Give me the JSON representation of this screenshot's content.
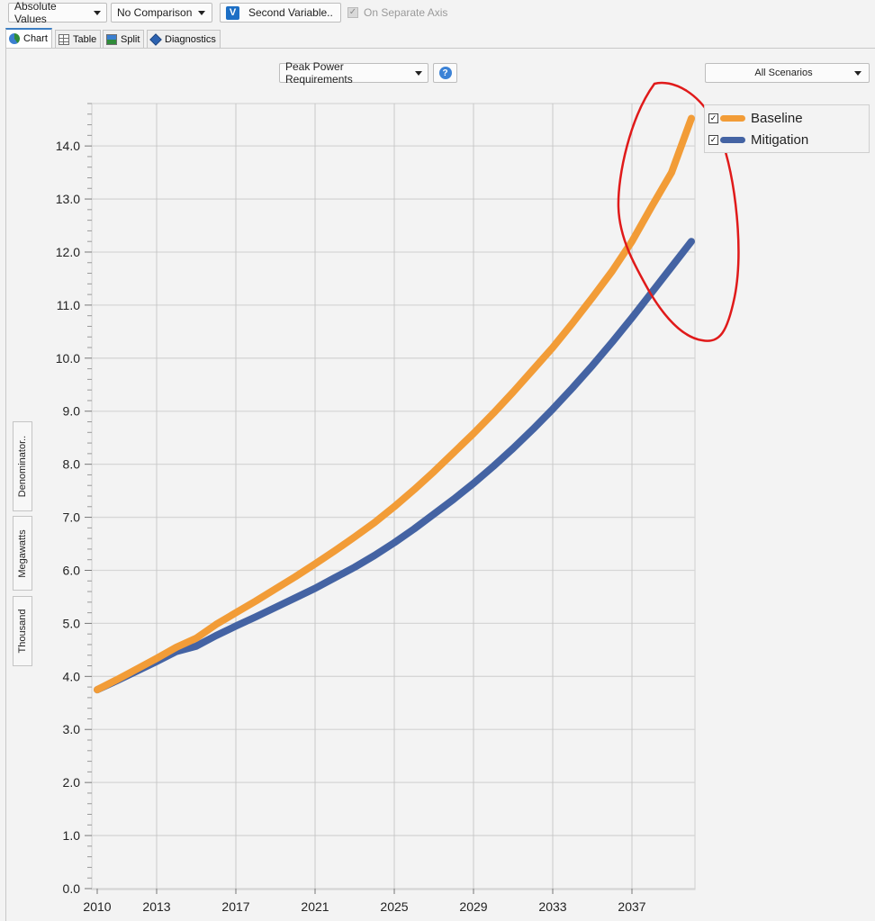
{
  "toolbar": {
    "value_mode": "Absolute Values",
    "comparison": "No Comparison",
    "second_variable": "Second Variable..",
    "second_variable_badge": "V",
    "separate_axis": "On Separate Axis"
  },
  "tabs": [
    {
      "label": "Chart",
      "active": true
    },
    {
      "label": "Table",
      "active": false
    },
    {
      "label": "Split",
      "active": false
    },
    {
      "label": "Diagnostics",
      "active": false
    }
  ],
  "side_tabs": [
    "Denominator..",
    "Megawatts",
    "Thousand"
  ],
  "chart_selector": "Peak Power Requirements",
  "help_symbol": "?",
  "scenario_selector": "All Scenarios",
  "legend_check": "✓",
  "colors": {
    "baseline": "#f29c37",
    "mitigation": "#4463a3",
    "annotation": "#e01a1a",
    "grid": "#d6d6d6"
  },
  "chart_data": {
    "type": "line",
    "x_tick_labels": [
      "2010",
      "2013",
      "2017",
      "2021",
      "2025",
      "2029",
      "2033",
      "2037"
    ],
    "y_tick_labels": [
      "0.0",
      "1.0",
      "2.0",
      "3.0",
      "4.0",
      "5.0",
      "6.0",
      "7.0",
      "8.0",
      "9.0",
      "10.0",
      "11.0",
      "12.0",
      "13.0",
      "14.0"
    ],
    "xlim": [
      2010,
      2040
    ],
    "ylim": [
      0,
      14.8
    ],
    "grid": true,
    "legend_position": "top-right",
    "x": [
      2010,
      2011,
      2012,
      2013,
      2014,
      2015,
      2016,
      2017,
      2018,
      2019,
      2020,
      2021,
      2022,
      2023,
      2024,
      2025,
      2026,
      2027,
      2028,
      2029,
      2030,
      2031,
      2032,
      2033,
      2034,
      2035,
      2036,
      2037,
      2038,
      2039,
      2040
    ],
    "series": [
      {
        "name": "Baseline",
        "values": [
          3.75,
          3.94,
          4.14,
          4.34,
          4.55,
          4.72,
          4.98,
          5.2,
          5.42,
          5.65,
          5.88,
          6.12,
          6.37,
          6.63,
          6.9,
          7.2,
          7.52,
          7.86,
          8.22,
          8.58,
          8.96,
          9.36,
          9.78,
          10.2,
          10.66,
          11.14,
          11.64,
          12.2,
          12.86,
          13.5,
          14.52
        ]
      },
      {
        "name": "Mitigation",
        "values": [
          3.75,
          3.92,
          4.1,
          4.28,
          4.47,
          4.57,
          4.77,
          4.95,
          5.12,
          5.3,
          5.48,
          5.66,
          5.86,
          6.06,
          6.28,
          6.52,
          6.78,
          7.06,
          7.34,
          7.64,
          7.96,
          8.3,
          8.66,
          9.04,
          9.44,
          9.86,
          10.3,
          10.76,
          11.24,
          11.72,
          12.2
        ]
      }
    ]
  }
}
